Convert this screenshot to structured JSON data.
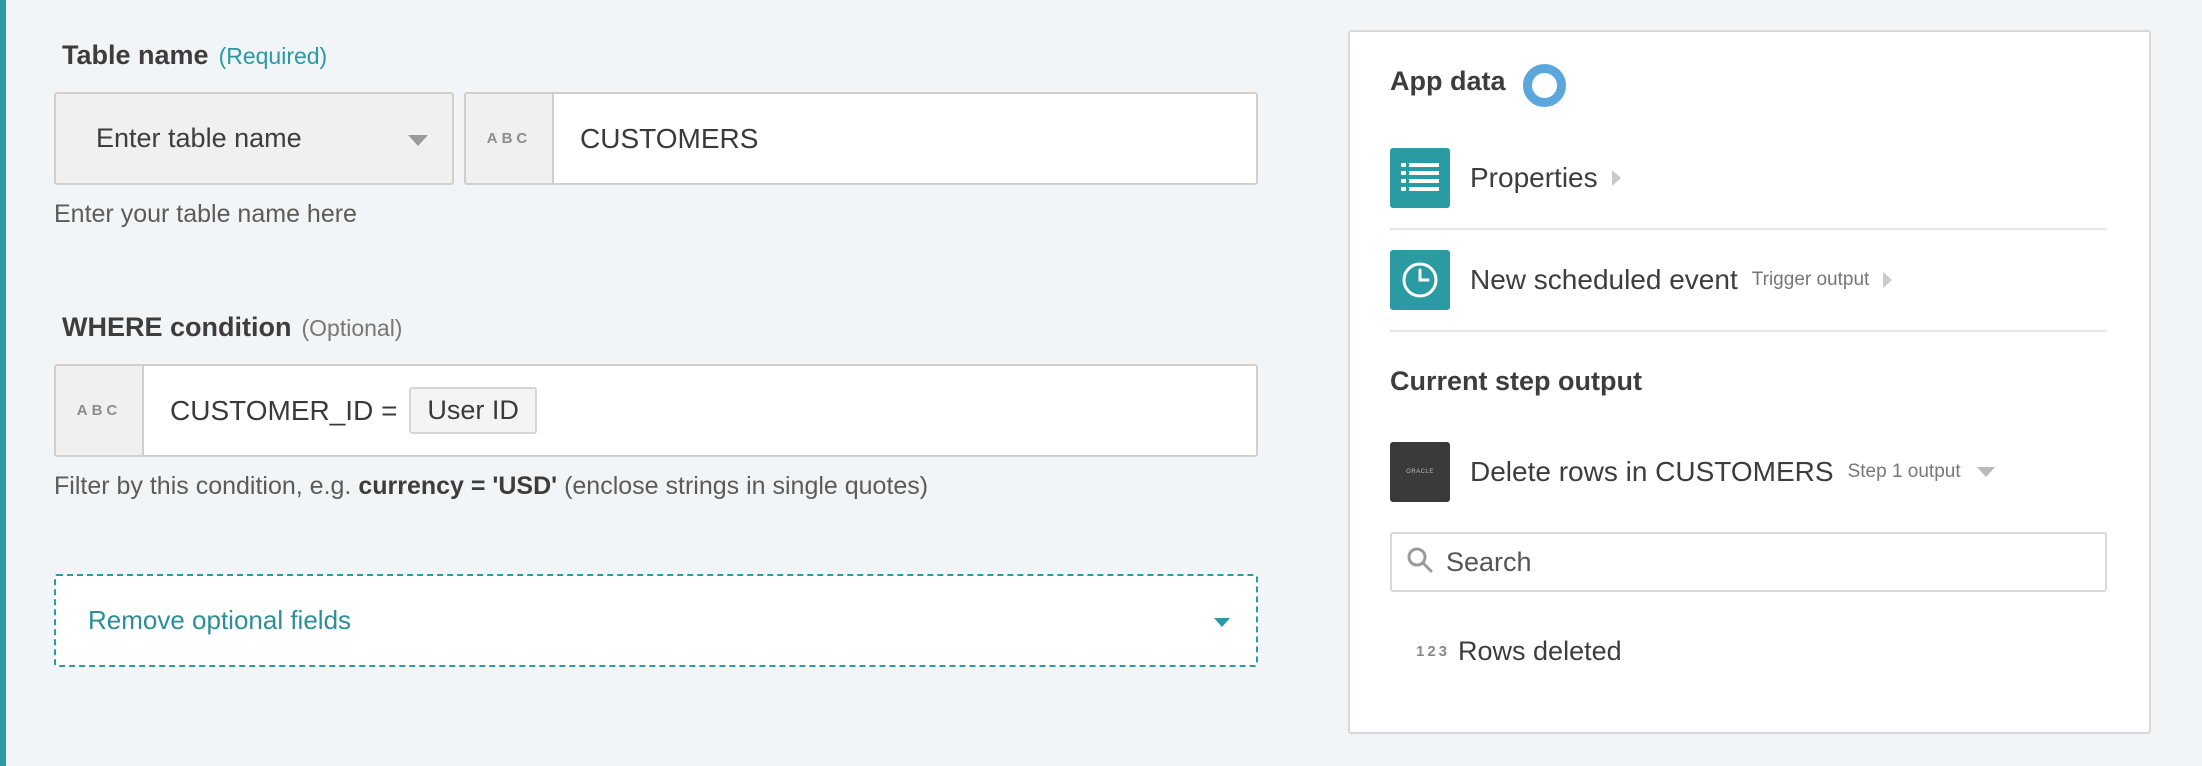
{
  "colors": {
    "accent": "#2a9aa3",
    "background": "#f1f5f7",
    "spinner": "#5ba7dc",
    "oracle_icon": "#3a3a3a"
  },
  "table_name": {
    "label": "Table name",
    "required_tag": "(Required)",
    "mode_select": "Enter table name",
    "type_badge": "ABC",
    "value": "CUSTOMERS",
    "help": "Enter your table name here"
  },
  "where": {
    "label": "WHERE condition",
    "optional_tag": "(Optional)",
    "type_badge": "ABC",
    "value_prefix": "CUSTOMER_ID =",
    "pill": "User ID",
    "help_prefix": "Filter by this condition, e.g.",
    "help_example": "currency = 'USD'",
    "help_suffix": "(enclose strings in single quotes)"
  },
  "optional_fields_toggle": "Remove optional fields",
  "panel": {
    "app_data_heading": "App data",
    "properties": {
      "label": "Properties",
      "icon": "list-icon"
    },
    "scheduled_event": {
      "label": "New scheduled event",
      "sub": "Trigger output",
      "icon": "clock-icon"
    },
    "current_step_heading": "Current step output",
    "delete_rows": {
      "label": "Delete rows in CUSTOMERS",
      "sub": "Step 1 output",
      "icon_text": "ORACLE"
    },
    "search_placeholder": "Search",
    "output_field": {
      "type_badge": "123",
      "label": "Rows deleted"
    }
  }
}
